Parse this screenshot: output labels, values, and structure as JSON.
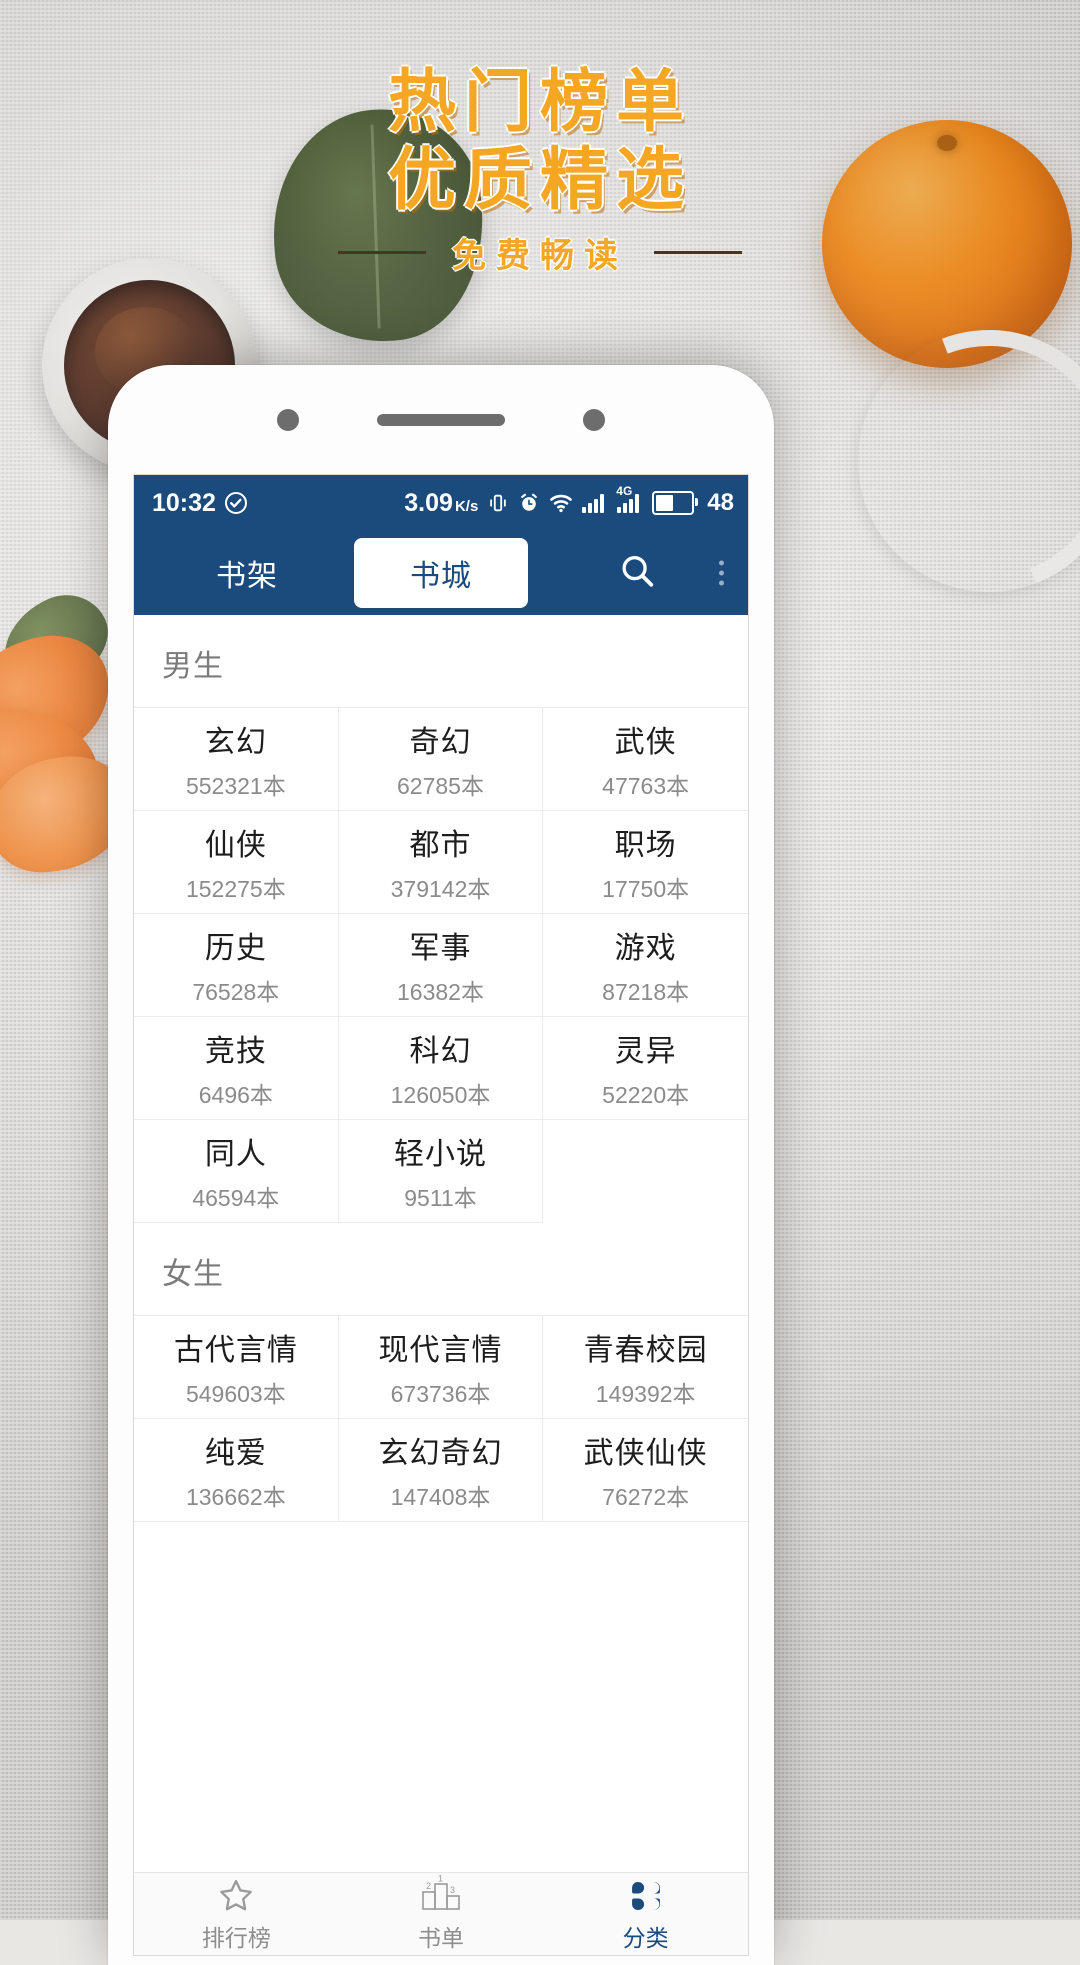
{
  "poster": {
    "headline_line1": "热门榜单",
    "headline_line2": "优质精选",
    "subtitle": "免费畅读",
    "accent_color": "#f5a623",
    "rule_color": "#4a3420"
  },
  "statusbar": {
    "time": "10:32",
    "check_icon": "check-circle-icon",
    "net_speed": "3.09",
    "net_speed_unit": "K/s",
    "vibrate_icon": "vibrate-icon",
    "alarm_icon": "alarm-clock-icon",
    "wifi_icon": "wifi-icon",
    "signal1_icon": "signal-bars-icon",
    "signal2_icon": "signal-bars-4g-icon",
    "signal2_badge": "4G",
    "battery_icon": "battery-icon",
    "battery_level": "48",
    "bar_color": "#1a4b7c"
  },
  "appbar": {
    "tab_shelf": "书架",
    "tab_store": "书城",
    "search_icon": "search-icon",
    "more_icon": "more-options-icon",
    "bg_color": "#1a4b7c",
    "active_tab_text_color": "#1a4b7c"
  },
  "sections": [
    {
      "title": "男生",
      "items": [
        {
          "name": "玄幻",
          "count": "552321本"
        },
        {
          "name": "奇幻",
          "count": "62785本"
        },
        {
          "name": "武侠",
          "count": "47763本"
        },
        {
          "name": "仙侠",
          "count": "152275本"
        },
        {
          "name": "都市",
          "count": "379142本"
        },
        {
          "name": "职场",
          "count": "17750本"
        },
        {
          "name": "历史",
          "count": "76528本"
        },
        {
          "name": "军事",
          "count": "16382本"
        },
        {
          "name": "游戏",
          "count": "87218本"
        },
        {
          "name": "竞技",
          "count": "6496本"
        },
        {
          "name": "科幻",
          "count": "126050本"
        },
        {
          "name": "灵异",
          "count": "52220本"
        },
        {
          "name": "同人",
          "count": "46594本"
        },
        {
          "name": "轻小说",
          "count": "9511本"
        },
        {
          "name": "",
          "count": ""
        }
      ]
    },
    {
      "title": "女生",
      "items": [
        {
          "name": "古代言情",
          "count": "549603本"
        },
        {
          "name": "现代言情",
          "count": "673736本"
        },
        {
          "name": "青春校园",
          "count": "149392本"
        },
        {
          "name": "纯爱",
          "count": "136662本"
        },
        {
          "name": "玄幻奇幻",
          "count": "147408本"
        },
        {
          "name": "武侠仙侠",
          "count": "76272本"
        }
      ]
    }
  ],
  "bottomnav": {
    "items": [
      {
        "label": "排行榜",
        "icon": "star-icon",
        "active": false
      },
      {
        "label": "书单",
        "icon": "podium-icon",
        "active": false
      },
      {
        "label": "分类",
        "icon": "grid-category-icon",
        "active": true
      }
    ],
    "podium_labels": {
      "first": "1",
      "second": "2",
      "third": "3"
    },
    "active_color": "#1a4b7c",
    "inactive_color": "#8e8e8e"
  }
}
